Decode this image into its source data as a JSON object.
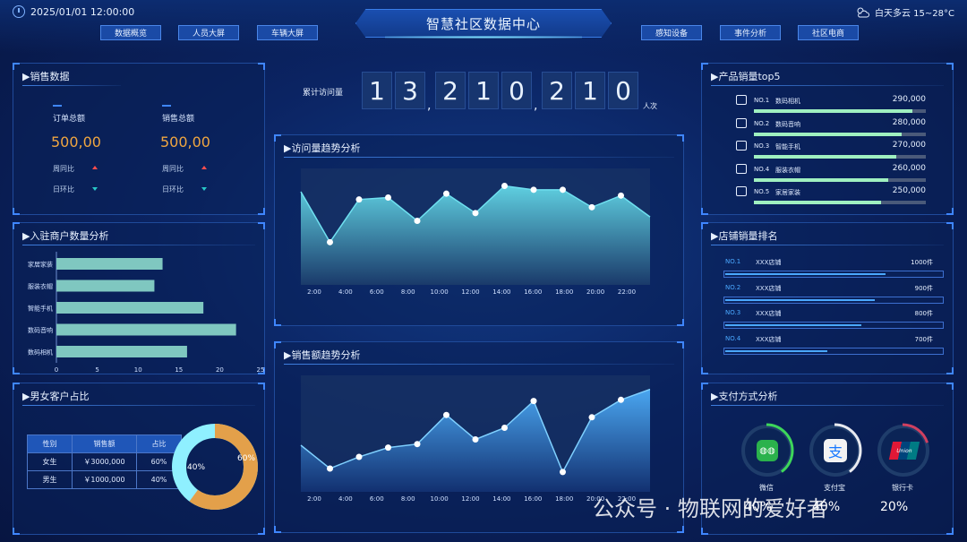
{
  "header": {
    "datetime": "2025/01/01  12:00:00",
    "title": "智慧社区数据中心",
    "weather": "白天多云  15~28°C",
    "nav_left": [
      "数据概览",
      "人员大屏",
      "车辆大屏"
    ],
    "nav_right": [
      "感知设备",
      "事件分析",
      "社区电商"
    ]
  },
  "sales": {
    "title": "▶销售数据",
    "order_label": "订单总额",
    "order_value": "500,00",
    "sales_label": "销售总额",
    "sales_value": "500,00",
    "wow": "周同比",
    "dod": "日环比"
  },
  "visits": {
    "label": "累计访问量",
    "digits": [
      "1",
      "3",
      "2",
      "1",
      "0",
      "2",
      "1",
      "0"
    ],
    "unit": "人次"
  },
  "merchants": {
    "title": "▶入驻商户数量分析",
    "chart_data": {
      "type": "bar",
      "categories": [
        "家居家装",
        "服装衣帽",
        "智能手机",
        "数码音响",
        "数码相机"
      ],
      "values": [
        13,
        12,
        18,
        22,
        16
      ],
      "xlim": [
        0,
        25
      ],
      "xticks": [
        "0",
        "5",
        "10",
        "15",
        "20",
        "25"
      ]
    }
  },
  "visit_trend": {
    "title": "▶访问量趋势分析",
    "chart_data": {
      "type": "area",
      "x": [
        "2:00",
        "4:00",
        "6:00",
        "8:00",
        "10:00",
        "12:00",
        "14:00",
        "16:00",
        "18:00",
        "20:00",
        "22:00"
      ],
      "values": [
        48,
        22,
        44,
        45,
        33,
        47,
        37,
        51,
        49,
        49,
        40,
        46,
        35
      ]
    }
  },
  "sales_trend": {
    "title": "▶销售额趋势分析",
    "chart_data": {
      "type": "area",
      "x": [
        "2:00",
        "4:00",
        "6:00",
        "8:00",
        "10:00",
        "12:00",
        "14:00",
        "16:00",
        "18:00",
        "20:00",
        "22:00"
      ],
      "values": [
        40,
        20,
        30,
        38,
        41,
        66,
        45,
        55,
        78,
        17,
        64,
        79,
        88
      ]
    }
  },
  "gender": {
    "title": "▶男女客户占比",
    "headers": [
      "性别",
      "销售额",
      "占比"
    ],
    "rows": [
      [
        "女生",
        "￥3000,000",
        "60%"
      ],
      [
        "男生",
        "￥1000,000",
        "40%"
      ]
    ],
    "pie_labels": [
      "60%",
      "40%"
    ],
    "chart_data": {
      "type": "pie",
      "categories": [
        "女生",
        "男生"
      ],
      "values": [
        60,
        40
      ]
    }
  },
  "top5": {
    "title": "▶产品销量top5",
    "items": [
      {
        "rank": "NO.1",
        "name": "数码相机",
        "value": "290,000",
        "pct": 0.92,
        "icon": "camera-icon"
      },
      {
        "rank": "NO.2",
        "name": "数码音响",
        "value": "280,000",
        "pct": 0.86,
        "icon": "speaker-icon"
      },
      {
        "rank": "NO.3",
        "name": "智能手机",
        "value": "270,000",
        "pct": 0.83,
        "icon": "phone-icon"
      },
      {
        "rank": "NO.4",
        "name": "服装衣帽",
        "value": "260,000",
        "pct": 0.78,
        "icon": "shirt-icon"
      },
      {
        "rank": "NO.5",
        "name": "家居家装",
        "value": "250,000",
        "pct": 0.74,
        "icon": "sofa-icon"
      }
    ]
  },
  "shops": {
    "title": "▶店铺销量排名",
    "items": [
      {
        "rank": "NO.1",
        "name": "XXX店铺",
        "value": "1000件",
        "pct": 0.74
      },
      {
        "rank": "NO.2",
        "name": "XXX店铺",
        "value": "900件",
        "pct": 0.69
      },
      {
        "rank": "NO.3",
        "name": "XXX店铺",
        "value": "800件",
        "pct": 0.63
      },
      {
        "rank": "NO.4",
        "name": "XXX店铺",
        "value": "700件",
        "pct": 0.47
      }
    ]
  },
  "payment": {
    "title": "▶支付方式分析",
    "items": [
      {
        "name": "微信",
        "pct": "40%"
      },
      {
        "name": "支付宝",
        "pct": "40%"
      },
      {
        "name": "银行卡",
        "pct": "20%"
      }
    ]
  },
  "watermark": "公众号 · 物联网的爱好者"
}
